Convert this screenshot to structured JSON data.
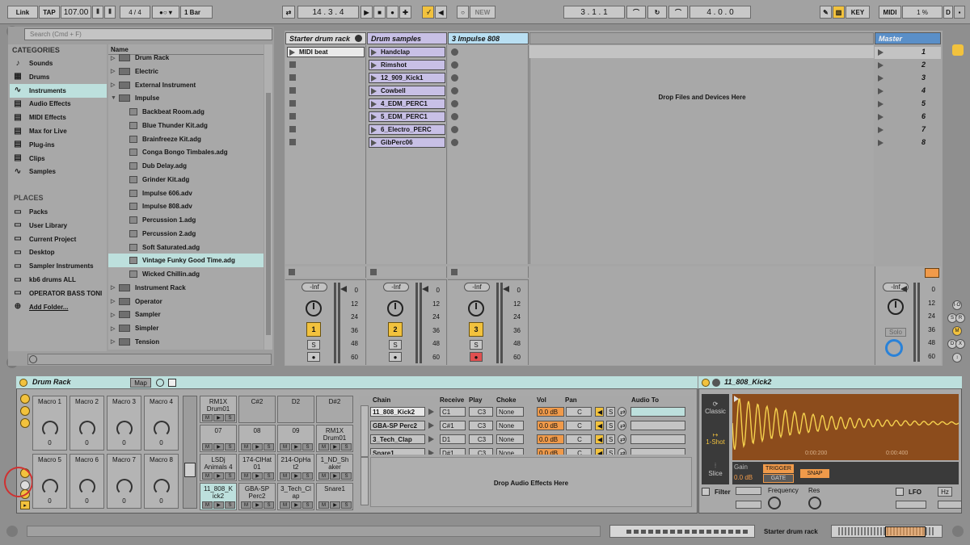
{
  "toolbar": {
    "link": "Link",
    "tap": "TAP",
    "tempo": "107.00",
    "signature": "4 / 4",
    "quantize": "1 Bar",
    "position": "14 .   3 .   4",
    "new_label": "NEW",
    "loop_start": "3 .   1 .   1",
    "loop_length": "4 .   0 .   0",
    "key_label": "KEY",
    "midi_label": "MIDI",
    "cpu": "1 %",
    "cpu_unit": "D"
  },
  "browser": {
    "search_placeholder": "Search (Cmd + F)",
    "categories_title": "CATEGORIES",
    "categories": [
      {
        "label": "Sounds",
        "icon": "note-icon"
      },
      {
        "label": "Drums",
        "icon": "grid-icon"
      },
      {
        "label": "Instruments",
        "icon": "wave-icon"
      },
      {
        "label": "Audio Effects",
        "icon": "audio-fx-icon"
      },
      {
        "label": "MIDI Effects",
        "icon": "midi-fx-icon"
      },
      {
        "label": "Max for Live",
        "icon": "max-icon"
      },
      {
        "label": "Plug-ins",
        "icon": "plug-icon"
      },
      {
        "label": "Clips",
        "icon": "clips-icon"
      },
      {
        "label": "Samples",
        "icon": "samples-icon"
      }
    ],
    "places_title": "PLACES",
    "places": [
      "Packs",
      "User Library",
      "Current Project",
      "Desktop",
      "Sampler Instruments",
      "kb6 drums ALL",
      "OPERATOR BASS TONI",
      "Add Folder..."
    ],
    "name_header": "Name",
    "items": [
      {
        "label": "Drum Rack",
        "folder": true
      },
      {
        "label": "Electric",
        "folder": true
      },
      {
        "label": "External Instrument",
        "folder": false
      },
      {
        "label": "Impulse",
        "folder": true,
        "open": true
      },
      {
        "label": "Backbeat Room.adg",
        "file": true
      },
      {
        "label": "Blue Thunder Kit.adg",
        "file": true
      },
      {
        "label": "Brainfreeze Kit.adg",
        "file": true
      },
      {
        "label": "Conga Bongo Timbales.adg",
        "file": true
      },
      {
        "label": "Dub Delay.adg",
        "file": true
      },
      {
        "label": "Grinder Kit.adg",
        "file": true
      },
      {
        "label": "Impulse 606.adv",
        "file": true
      },
      {
        "label": "Impulse 808.adv",
        "file": true
      },
      {
        "label": "Percussion 1.adg",
        "file": true
      },
      {
        "label": "Percussion 2.adg",
        "file": true
      },
      {
        "label": "Soft Saturated.adg",
        "file": true
      },
      {
        "label": "Vintage Funky Good Time.adg",
        "file": true,
        "selected": true
      },
      {
        "label": "Wicked Chillin.adg",
        "file": true
      },
      {
        "label": "Instrument Rack",
        "folder": true
      },
      {
        "label": "Operator",
        "folder": true
      },
      {
        "label": "Sampler",
        "folder": true
      },
      {
        "label": "Simpler",
        "folder": true
      },
      {
        "label": "Tension",
        "folder": true
      }
    ]
  },
  "session": {
    "tracks": [
      {
        "name": "Starter drum rack",
        "color": "#d9d9d9",
        "clips": [
          "MIDI beat"
        ],
        "number": "1"
      },
      {
        "name": "Drum samples",
        "color": "#c8c0e6",
        "clips": [
          "Handclap",
          "Rimshot",
          "12_909_Kick1",
          "Cowbell",
          "4_EDM_PERC1",
          "5_EDM_PERC1",
          "6_Electro_PERC",
          "GibPerc06"
        ],
        "number": "2"
      },
      {
        "name": "3 Impulse 808",
        "color": "#b9dff2",
        "clips": [],
        "number": "3"
      }
    ],
    "drop_text": "Drop Files and Devices Here",
    "master_name": "Master",
    "scenes": [
      "1",
      "2",
      "3",
      "4",
      "5",
      "6",
      "7",
      "8"
    ],
    "volume": "-Inf",
    "solo_label": "Solo",
    "scale": [
      "0",
      "12",
      "24",
      "36",
      "48",
      "60"
    ],
    "s_label": "S"
  },
  "drum_rack": {
    "title": "Drum Rack",
    "map_label": "Map",
    "macros": [
      {
        "label": "Macro 1",
        "value": "0"
      },
      {
        "label": "Macro 2",
        "value": "0"
      },
      {
        "label": "Macro 3",
        "value": "0"
      },
      {
        "label": "Macro 4",
        "value": "0"
      },
      {
        "label": "Macro 5",
        "value": "0"
      },
      {
        "label": "Macro 6",
        "value": "0"
      },
      {
        "label": "Macro 7",
        "value": "0"
      },
      {
        "label": "Macro 8",
        "value": "0"
      }
    ],
    "pads": [
      {
        "label": "RM1X Drum01",
        "filled": true
      },
      {
        "label": "C#2",
        "filled": false
      },
      {
        "label": "D2",
        "filled": false
      },
      {
        "label": "D#2",
        "filled": false
      },
      {
        "label": "07",
        "filled": true
      },
      {
        "label": "08",
        "filled": true
      },
      {
        "label": "09",
        "filled": true
      },
      {
        "label": "RM1X Drum01",
        "filled": true
      },
      {
        "label": "LSDj Animals 4",
        "filled": true
      },
      {
        "label": "174-ClHat 01",
        "filled": true
      },
      {
        "label": "214-OpHa t2",
        "filled": true
      },
      {
        "label": "1_ND_Sh aker",
        "filled": true
      },
      {
        "label": "11_808_K ick2",
        "filled": true,
        "selected": true
      },
      {
        "label": "GBA-SP Perc2",
        "filled": true
      },
      {
        "label": "3_Tech_Cl ap",
        "filled": true
      },
      {
        "label": "Snare1",
        "filled": true
      }
    ],
    "pad_buttons": [
      "M",
      "▶",
      "S"
    ],
    "chain_headers": [
      "Chain",
      "Receive",
      "Play",
      "Choke",
      "Vol",
      "Pan",
      "Audio To"
    ],
    "chains": [
      {
        "name": "11_808_Kick2",
        "receive": "C1",
        "play": "C3",
        "choke": "None",
        "vol": "0.0 dB",
        "pan": "C"
      },
      {
        "name": "GBA-SP Perc2",
        "receive": "C#1",
        "play": "C3",
        "choke": "None",
        "vol": "0.0 dB",
        "pan": "C"
      },
      {
        "name": "3_Tech_Clap",
        "receive": "D1",
        "play": "C3",
        "choke": "None",
        "vol": "0.0 dB",
        "pan": "C"
      },
      {
        "name": "Snare1",
        "receive": "D#1",
        "play": "C3",
        "choke": "None",
        "vol": "0.0 dB",
        "pan": "C"
      }
    ],
    "drop_effects": "Drop Audio Effects Here"
  },
  "simpler": {
    "title": "11_808_Kick2",
    "modes": [
      "Classic",
      "1-Shot",
      "Slice"
    ],
    "time1": "0:00:200",
    "time2": "0:00:400",
    "gain_label": "Gain",
    "gain_value": "0.0 dB",
    "trigger": "TRIGGER",
    "gate": "GATE",
    "snap": "SNAP",
    "filter": "Filter",
    "frequency": "Frequency",
    "res": "Res",
    "lfo": "LFO",
    "hz": "Hz"
  },
  "status": {
    "track_label": "Starter drum rack"
  },
  "colors": {
    "accent": "#f2c23d",
    "clip_purple": "#c8c0e6",
    "clip_blue": "#b9dff2",
    "selection": "#bde0dd",
    "waveform_bg": "#8c4c1c",
    "waveform": "#f6d24e",
    "orange": "#f09a4a"
  }
}
